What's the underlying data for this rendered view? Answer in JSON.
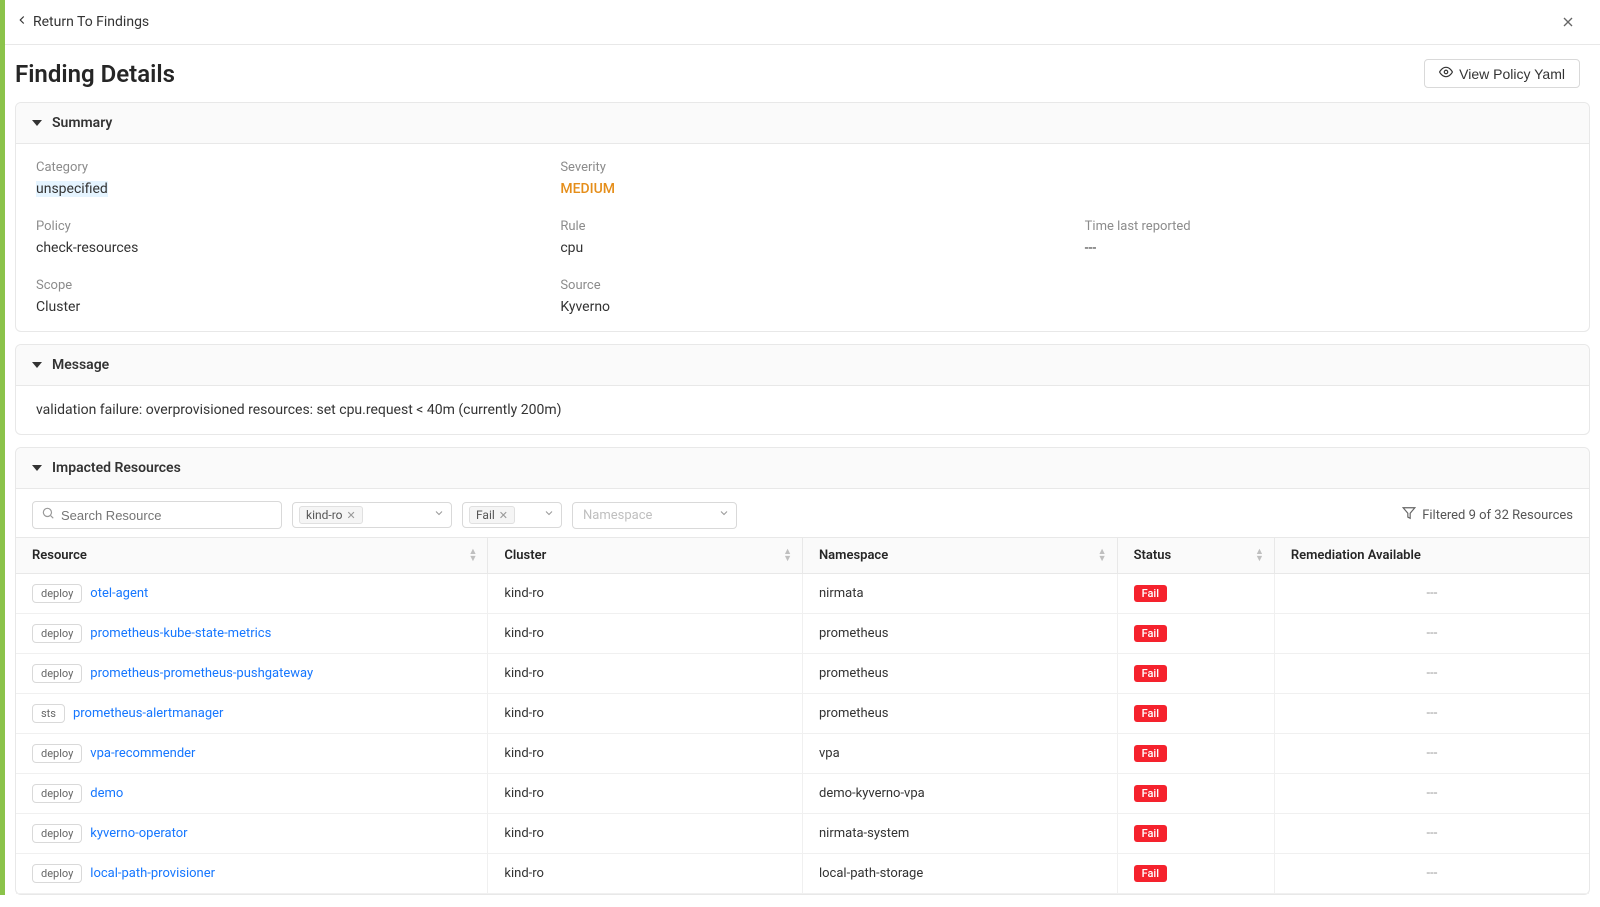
{
  "top": {
    "return_label": "Return To Findings"
  },
  "title_row": {
    "title": "Finding Details",
    "view_yaml_label": "View Policy Yaml"
  },
  "sections": {
    "summary_title": "Summary",
    "message_title": "Message",
    "impacted_title": "Impacted Resources"
  },
  "summary": {
    "category_label": "Category",
    "category_value": "unspecified",
    "severity_label": "Severity",
    "severity_value": "MEDIUM",
    "policy_label": "Policy",
    "policy_value": "check-resources",
    "rule_label": "Rule",
    "rule_value": "cpu",
    "time_label": "Time last reported",
    "time_value": "---",
    "scope_label": "Scope",
    "scope_value": "Cluster",
    "source_label": "Source",
    "source_value": "Kyverno"
  },
  "message": {
    "text": "validation failure: overprovisioned resources: set cpu.request < 40m (currently 200m)"
  },
  "filters": {
    "search_placeholder": "Search Resource",
    "cluster_tag": "kind-ro",
    "status_tag": "Fail",
    "namespace_placeholder": "Namespace",
    "filtered_text": "Filtered 9 of 32 Resources"
  },
  "columns": {
    "resource": "Resource",
    "cluster": "Cluster",
    "namespace": "Namespace",
    "status": "Status",
    "remediation": "Remediation Available"
  },
  "rows": [
    {
      "kind": "deploy",
      "name": "otel-agent",
      "cluster": "kind-ro",
      "namespace": "nirmata",
      "status": "Fail",
      "remediation": "---"
    },
    {
      "kind": "deploy",
      "name": "prometheus-kube-state-metrics",
      "cluster": "kind-ro",
      "namespace": "prometheus",
      "status": "Fail",
      "remediation": "---"
    },
    {
      "kind": "deploy",
      "name": "prometheus-prometheus-pushgateway",
      "cluster": "kind-ro",
      "namespace": "prometheus",
      "status": "Fail",
      "remediation": "---"
    },
    {
      "kind": "sts",
      "name": "prometheus-alertmanager",
      "cluster": "kind-ro",
      "namespace": "prometheus",
      "status": "Fail",
      "remediation": "---"
    },
    {
      "kind": "deploy",
      "name": "vpa-recommender",
      "cluster": "kind-ro",
      "namespace": "vpa",
      "status": "Fail",
      "remediation": "---"
    },
    {
      "kind": "deploy",
      "name": "demo",
      "cluster": "kind-ro",
      "namespace": "demo-kyverno-vpa",
      "status": "Fail",
      "remediation": "---"
    },
    {
      "kind": "deploy",
      "name": "kyverno-operator",
      "cluster": "kind-ro",
      "namespace": "nirmata-system",
      "status": "Fail",
      "remediation": "---"
    },
    {
      "kind": "deploy",
      "name": "local-path-provisioner",
      "cluster": "kind-ro",
      "namespace": "local-path-storage",
      "status": "Fail",
      "remediation": "---"
    }
  ]
}
